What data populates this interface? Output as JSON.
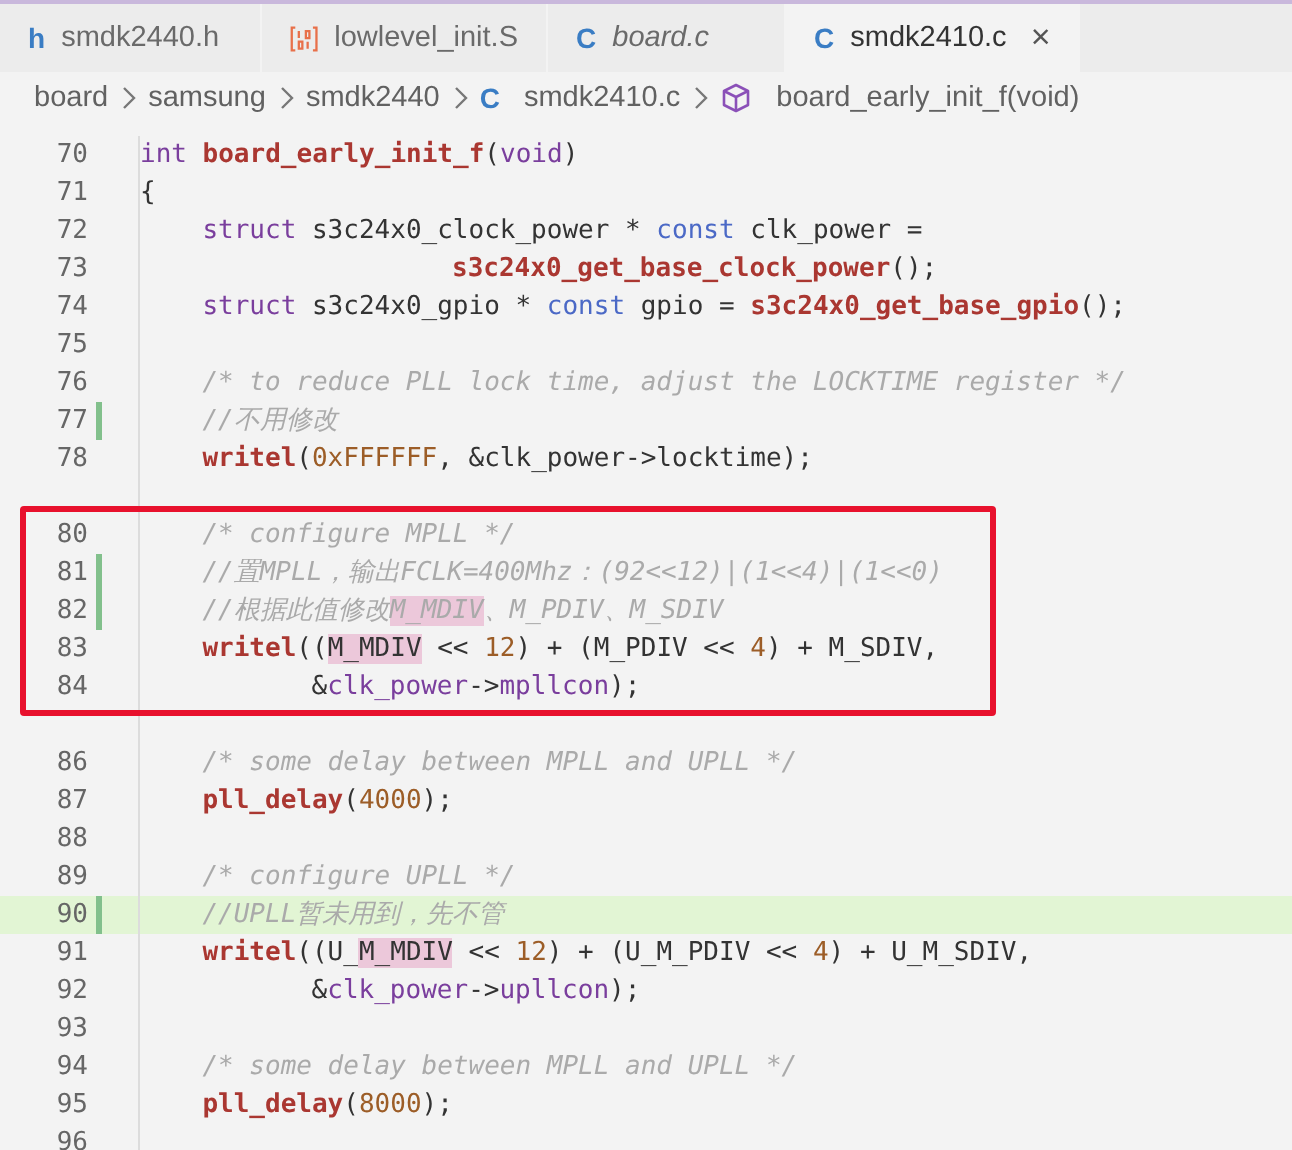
{
  "tabs": [
    {
      "label": "smdk2440.h",
      "kind": "header",
      "badge": "h",
      "selected": false,
      "preview": false
    },
    {
      "label": "lowlevel_init.S",
      "kind": "assembly",
      "selected": false,
      "preview": false
    },
    {
      "label": "board.c",
      "kind": "c",
      "badge": "C",
      "selected": false,
      "preview": true
    },
    {
      "label": "smdk2410.c",
      "kind": "c",
      "badge": "C",
      "selected": true,
      "preview": false,
      "close": "×"
    }
  ],
  "breadcrumb": [
    {
      "text": "board",
      "kind": "folder"
    },
    {
      "text": "samsung",
      "kind": "folder"
    },
    {
      "text": "smdk2440",
      "kind": "folder"
    },
    {
      "text": "smdk2410.c",
      "kind": "file",
      "badge": "C"
    },
    {
      "text": "board_early_init_f(void)",
      "kind": "symbol"
    }
  ],
  "lines": [
    {
      "number": "70",
      "kind": "top",
      "changed": false,
      "current": false,
      "boxed": false,
      "tokens": [
        {
          "kind": "keyword",
          "text": "int"
        },
        {
          "kind": "function",
          "text": "board_early_init_f"
        },
        {
          "kind": "plain",
          "text": "("
        },
        {
          "kind": "keyword",
          "text": "void"
        },
        {
          "kind": "plain",
          "text": ")"
        }
      ]
    },
    {
      "number": "71",
      "kind": "top",
      "changed": false,
      "current": false,
      "boxed": false,
      "tokens": [
        {
          "kind": "plain",
          "text": "{"
        }
      ]
    },
    {
      "number": "72",
      "kind": "body",
      "changed": false,
      "current": false,
      "boxed": false,
      "tokens": [
        {
          "kind": "keyword",
          "text": "struct"
        },
        {
          "kind": "plain",
          "text": " s3c24x0_clock_power * "
        },
        {
          "kind": "modifier",
          "text": "const"
        },
        {
          "kind": "plain",
          "text": " clk_power ="
        }
      ]
    },
    {
      "number": "73",
      "kind": "wrapped_call",
      "changed": false,
      "current": false,
      "boxed": false,
      "tokens": [
        {
          "kind": "function",
          "text": "s3c24x0_get_base_clock_power"
        },
        {
          "kind": "plain",
          "text": "();"
        }
      ]
    },
    {
      "number": "74",
      "kind": "body",
      "changed": false,
      "current": false,
      "boxed": false,
      "tokens": [
        {
          "kind": "keyword",
          "text": "struct"
        },
        {
          "kind": "plain",
          "text": " s3c24x0_gpio * "
        },
        {
          "kind": "modifier",
          "text": "const"
        },
        {
          "kind": "plain",
          "text": " gpio = "
        },
        {
          "kind": "function",
          "text": "s3c24x0_get_base_gpio"
        },
        {
          "kind": "plain",
          "text": "();"
        }
      ]
    },
    {
      "number": "75",
      "kind": "body",
      "changed": false,
      "current": false,
      "boxed": false
    },
    {
      "number": "76",
      "kind": "body",
      "changed": false,
      "current": false,
      "boxed": false,
      "tokens": [
        {
          "kind": "comment",
          "text": "/* to reduce PLL lock time, adjust the LOCKTIME register */"
        }
      ]
    },
    {
      "number": "77",
      "kind": "body",
      "changed": true,
      "current": false,
      "boxed": false,
      "tokens": [
        {
          "kind": "comment",
          "text": "//不用修改"
        }
      ]
    },
    {
      "number": "78",
      "kind": "body",
      "changed": false,
      "current": false,
      "boxed": false,
      "tokens": [
        {
          "kind": "function",
          "text": "writel"
        },
        {
          "kind": "plain",
          "text": "("
        },
        {
          "kind": "number",
          "text": "0xFFFFFF"
        },
        {
          "kind": "plain",
          "text": ", &clk_power->locktime);"
        }
      ]
    },
    {
      "kind": "body",
      "changed": false,
      "current": false,
      "boxed": false
    },
    {
      "number": "80",
      "kind": "body",
      "changed": false,
      "current": false,
      "boxed": true,
      "tokens": [
        {
          "kind": "comment",
          "text": "/* configure MPLL */"
        }
      ]
    },
    {
      "number": "81",
      "kind": "body",
      "changed": true,
      "current": false,
      "boxed": true,
      "tokens": [
        {
          "kind": "comment",
          "text": "//置MPLL，输出FCLK=400Mhz：(92<<12)|(1<<4)|(1<<0)"
        }
      ]
    },
    {
      "number": "82",
      "kind": "body",
      "changed": true,
      "current": false,
      "boxed": true,
      "tokens": [
        {
          "kind": "comment",
          "text": "//根据此值修改"
        },
        {
          "kind": "comment_match",
          "text": "M_MDIV"
        },
        {
          "kind": "comment",
          "text": "、M_PDIV、M_SDIV"
        }
      ]
    },
    {
      "number": "83",
      "kind": "body",
      "changed": false,
      "current": false,
      "boxed": true,
      "tokens": [
        {
          "kind": "function",
          "text": "writel"
        },
        {
          "kind": "plain",
          "text": "(("
        },
        {
          "kind": "match",
          "text": "M_MDIV"
        },
        {
          "kind": "plain",
          "text": " << "
        },
        {
          "kind": "number",
          "text": "12"
        },
        {
          "kind": "plain",
          "text": ") + (M_PDIV << "
        },
        {
          "kind": "number",
          "text": "4"
        },
        {
          "kind": "plain",
          "text": ") + M_SDIV,"
        }
      ]
    },
    {
      "number": "84",
      "kind": "wrapped_args",
      "changed": false,
      "current": false,
      "boxed": true,
      "tokens": [
        {
          "kind": "plain",
          "text": "&"
        },
        {
          "kind": "field",
          "text": "clk_power"
        },
        {
          "kind": "plain",
          "text": "->"
        },
        {
          "kind": "field",
          "text": "mpllcon"
        },
        {
          "kind": "plain",
          "text": ");"
        }
      ]
    },
    {
      "kind": "body",
      "changed": false,
      "current": false,
      "boxed": false
    },
    {
      "number": "86",
      "kind": "body",
      "changed": false,
      "current": false,
      "boxed": false,
      "tokens": [
        {
          "kind": "comment",
          "text": "/* some delay between MPLL and UPLL */"
        }
      ]
    },
    {
      "number": "87",
      "kind": "body",
      "changed": false,
      "current": false,
      "boxed": false,
      "tokens": [
        {
          "kind": "function",
          "text": "pll_delay"
        },
        {
          "kind": "plain",
          "text": "("
        },
        {
          "kind": "number",
          "text": "4000"
        },
        {
          "kind": "plain",
          "text": ");"
        }
      ]
    },
    {
      "number": "88",
      "kind": "body",
      "changed": false,
      "current": false,
      "boxed": false
    },
    {
      "number": "89",
      "kind": "body",
      "changed": false,
      "current": false,
      "boxed": false,
      "tokens": [
        {
          "kind": "comment",
          "text": "/* configure UPLL */"
        }
      ]
    },
    {
      "number": "90",
      "kind": "body",
      "changed": true,
      "current": true,
      "boxed": false,
      "tokens": [
        {
          "kind": "comment",
          "text": "//UPLL暂未用到，先不管"
        }
      ]
    },
    {
      "number": "91",
      "kind": "body",
      "changed": false,
      "current": false,
      "boxed": false,
      "tokens": [
        {
          "kind": "function",
          "text": "writel"
        },
        {
          "kind": "plain",
          "text": "((U_"
        },
        {
          "kind": "match",
          "text": "M_MDIV"
        },
        {
          "kind": "plain",
          "text": " << "
        },
        {
          "kind": "number",
          "text": "12"
        },
        {
          "kind": "plain",
          "text": ") + (U_M_PDIV << "
        },
        {
          "kind": "number",
          "text": "4"
        },
        {
          "kind": "plain",
          "text": ") + U_M_SDIV,"
        }
      ]
    },
    {
      "number": "92",
      "kind": "wrapped_args",
      "changed": false,
      "current": false,
      "boxed": false,
      "tokens": [
        {
          "kind": "plain",
          "text": "&"
        },
        {
          "kind": "field",
          "text": "clk_power"
        },
        {
          "kind": "plain",
          "text": "->"
        },
        {
          "kind": "field",
          "text": "upllcon"
        },
        {
          "kind": "plain",
          "text": ");"
        }
      ]
    },
    {
      "number": "93",
      "kind": "body",
      "changed": false,
      "current": false,
      "boxed": false
    },
    {
      "number": "94",
      "kind": "body",
      "changed": false,
      "current": false,
      "boxed": false,
      "tokens": [
        {
          "kind": "comment",
          "text": "/* some delay between MPLL and UPLL */"
        }
      ]
    },
    {
      "number": "95",
      "kind": "body",
      "changed": false,
      "current": false,
      "boxed": false,
      "tokens": [
        {
          "kind": "function",
          "text": "pll_delay"
        },
        {
          "kind": "plain",
          "text": "("
        },
        {
          "kind": "number",
          "text": "8000"
        },
        {
          "kind": "plain",
          "text": ");"
        }
      ]
    },
    {
      "number": "96",
      "kind": "body",
      "changed": false,
      "current": false,
      "boxed": false
    }
  ]
}
